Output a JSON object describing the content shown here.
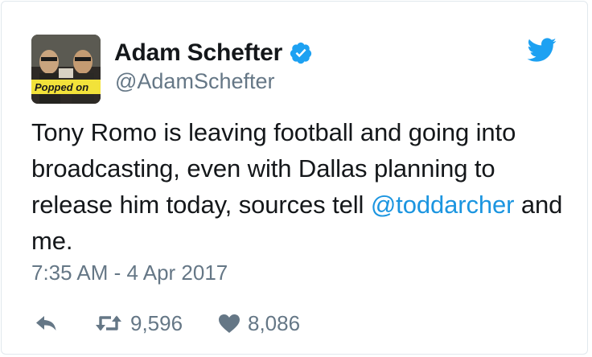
{
  "tweet": {
    "author": {
      "display_name": "Adam Schefter",
      "handle": "@AdamSchefter",
      "verified": true,
      "avatar_icon": "movie-poster-avatar"
    },
    "text": {
      "part1": "Tony Romo is leaving football and going into broadcasting, even with Dallas planning to release him today, sources tell ",
      "mention": "@toddarcher",
      "part2": " and me."
    },
    "timestamp": "7:35 AM - 4 Apr 2017",
    "stats": {
      "retweets": "9,596",
      "likes": "8,086"
    },
    "icons": {
      "brand": "twitter-bird-icon",
      "reply": "reply-icon",
      "retweet": "retweet-icon",
      "like": "heart-icon",
      "verified": "verified-badge-icon"
    },
    "colors": {
      "brand_blue": "#1da1f2",
      "link_blue": "#1b95e0",
      "muted_gray": "#657786",
      "text": "#14171a"
    }
  }
}
